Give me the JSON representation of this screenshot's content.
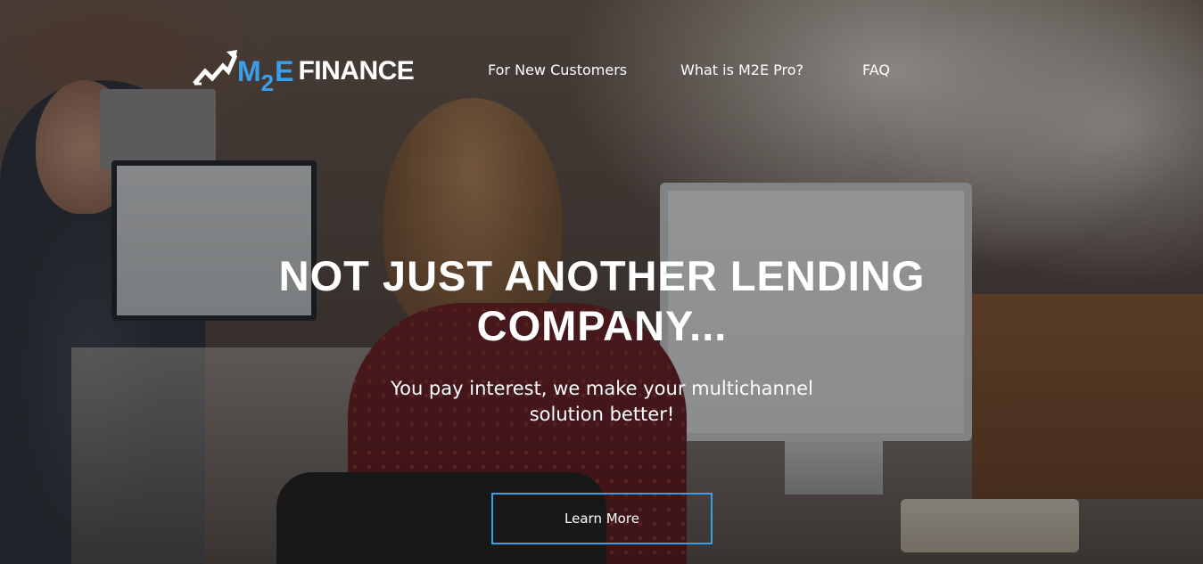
{
  "header": {
    "logo": {
      "icon": "growth-chart-arrow-icon",
      "text_m": "M",
      "text_2": "2",
      "text_e": "E",
      "text_finance": "FINANCE"
    },
    "nav": [
      {
        "label": "For New Customers"
      },
      {
        "label": "What is M2E Pro?"
      },
      {
        "label": "FAQ"
      }
    ]
  },
  "hero": {
    "title_line1": "NOT JUST ANOTHER LENDING",
    "title_line2": "COMPANY...",
    "subtitle_line1": "You pay interest, we make your multichannel",
    "subtitle_line2": "solution better!",
    "cta_label": "Learn More"
  },
  "colors": {
    "accent": "#3b9ee8",
    "text": "#ffffff",
    "overlay": "rgba(20,18,20,0.42)"
  }
}
